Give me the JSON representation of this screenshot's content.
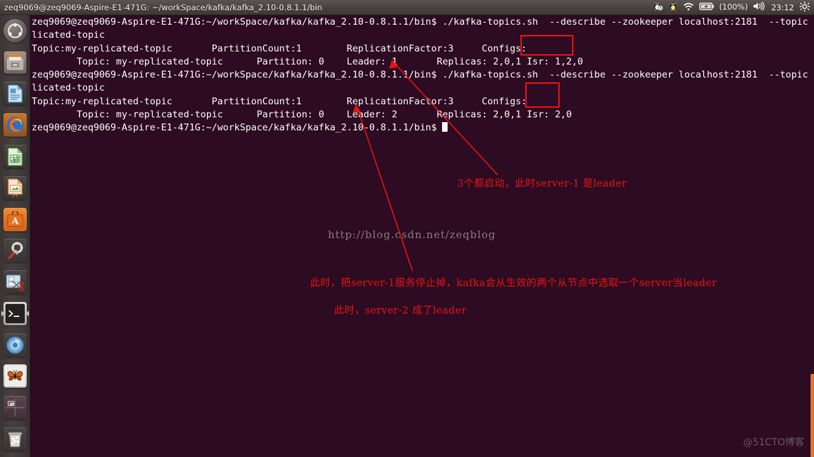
{
  "panel": {
    "title": "zeq9069@zeq9069-Aspire-E1-471G: ~/workSpace/kafka/kafka_2.10-0.8.1.1/bin",
    "tray": {
      "items": [
        {
          "name": "penguin-clock-icon",
          "glyph": "🐧"
        },
        {
          "name": "tux-icon",
          "glyph": "🐧"
        },
        {
          "name": "wifi-icon",
          "glyph": "wifi"
        },
        {
          "name": "battery-icon",
          "glyph": "battery"
        },
        {
          "name": "battery-percent",
          "label": "(100%)"
        },
        {
          "name": "volume-icon",
          "glyph": "volume"
        },
        {
          "name": "clock",
          "label": "23:12"
        },
        {
          "name": "session-gear-icon",
          "glyph": "gear"
        }
      ],
      "battery_label": "(100%)",
      "clock": "23:12"
    }
  },
  "launcher": {
    "items": [
      {
        "name": "sidebar-item-dash",
        "label": "Ubuntu Dash"
      },
      {
        "name": "sidebar-item-files",
        "label": "Files"
      },
      {
        "name": "sidebar-item-libreoffice-writer",
        "label": "LibreOffice Writer"
      },
      {
        "name": "sidebar-item-firefox",
        "label": "Firefox"
      },
      {
        "name": "sidebar-item-libreoffice-calc",
        "label": "LibreOffice Calc"
      },
      {
        "name": "sidebar-item-libreoffice-impress",
        "label": "LibreOffice Impress"
      },
      {
        "name": "sidebar-item-software-center",
        "label": "Ubuntu Software Center"
      },
      {
        "name": "sidebar-item-system-settings",
        "label": "System Settings"
      },
      {
        "name": "sidebar-item-screenshot",
        "label": "Screenshot"
      },
      {
        "name": "sidebar-item-terminal",
        "label": "Terminal"
      },
      {
        "name": "sidebar-item-chromium",
        "label": "Chromium"
      },
      {
        "name": "sidebar-item-image-viewer",
        "label": "Image Viewer"
      },
      {
        "name": "sidebar-item-workspace-switcher",
        "label": "Workspace Switcher"
      },
      {
        "name": "sidebar-item-trash",
        "label": "Trash"
      }
    ]
  },
  "terminal": {
    "prompt": "zeq9069@zeq9069-Aspire-E1-471G:~/workSpace/kafka/kafka_2.10-0.8.1.1/bin$ ",
    "command": "./kafka-topics.sh  --describe --zookeeper localhost:2181  --topic my-replicated-topic",
    "lines": [
      "zeq9069@zeq9069-Aspire-E1-471G:~/workSpace/kafka/kafka_2.10-0.8.1.1/bin$ ./kafka-topics.sh  --describe --zookeeper localhost:2181  --topic my-rep",
      "licated-topic",
      "Topic:my-replicated-topic       PartitionCount:1        ReplicationFactor:3     Configs:",
      "        Topic: my-replicated-topic      Partition: 0    Leader: 1       Replicas: 2,0,1 Isr: 1,2,0",
      "zeq9069@zeq9069-Aspire-E1-471G:~/workSpace/kafka/kafka_2.10-0.8.1.1/bin$ ./kafka-topics.sh  --describe --zookeeper localhost:2181  --topic my-rep",
      "licated-topic",
      "Topic:my-replicated-topic       PartitionCount:1        ReplicationFactor:3     Configs:",
      "        Topic: my-replicated-topic      Partition: 0    Leader: 2       Replicas: 2,0,1 Isr: 2,0",
      "zeq9069@zeq9069-Aspire-E1-471G:~/workSpace/kafka/kafka_2.10-0.8.1.1/bin$ "
    ],
    "topic": "my-replicated-topic",
    "partition_count": "1",
    "replication_factor": "3",
    "first_describe": {
      "partition": "0",
      "leader": "1",
      "replicas": "2,0,1",
      "isr": "1,2,0"
    },
    "second_describe": {
      "partition": "0",
      "leader": "2",
      "replicas": "2,0,1",
      "isr": "2,0"
    }
  },
  "annotations": {
    "note_leader1": "3个都启动，此时server-1 是leader",
    "note_stop_server1": "此时，把server-1服务停止掉，kafka会从生效的两个从节点中选取一个server当leader",
    "note_leader2": "此时，server-2 成了leader",
    "highlight_color": "#f01414"
  },
  "watermarks": {
    "blog_url": "http://blog.csdn.net/zeqblog",
    "site_mark": "@51CTO博客"
  },
  "colors": {
    "terminal_bg": "#2d0b22",
    "panel_bg": "#474240",
    "accent_orange": "#e8762a",
    "annotation_red": "#e81313"
  }
}
